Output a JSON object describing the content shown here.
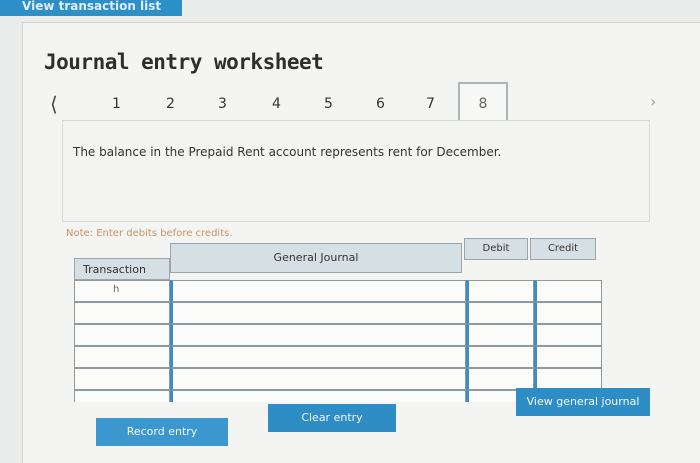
{
  "top_tab": {
    "label": "View transaction list"
  },
  "title": "Journal entry worksheet",
  "pager": {
    "prev_icon": "chevron-left-icon",
    "next_icon": "chevron-right-icon",
    "pages": [
      "1",
      "2",
      "3",
      "4",
      "5",
      "6",
      "7",
      "8"
    ],
    "active_page": "8"
  },
  "question": {
    "text": "The balance in the Prepaid Rent account represents rent for December."
  },
  "note": "Note: Enter debits before credits.",
  "journal": {
    "headers": {
      "transaction": "Transaction",
      "general_journal": "General Journal",
      "debit": "Debit",
      "credit": "Credit"
    },
    "rows": [
      {
        "transaction": "h"
      },
      {
        "transaction": ""
      },
      {
        "transaction": ""
      },
      {
        "transaction": ""
      },
      {
        "transaction": ""
      },
      {
        "transaction": ""
      }
    ]
  },
  "buttons": {
    "record": "Record entry",
    "clear": "Clear entry",
    "view": "View general journal"
  },
  "colors": {
    "accent": "#2f8dc6",
    "header_bg": "#d6dfe3",
    "note": "#c7926a"
  }
}
